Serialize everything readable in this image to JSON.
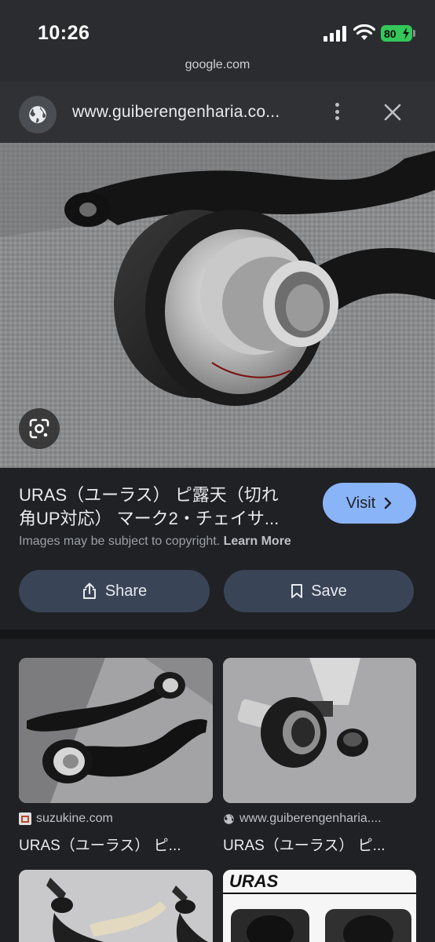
{
  "status_bar": {
    "time": "10:26",
    "battery": "80",
    "url": "google.com"
  },
  "header": {
    "site_url": "www.guiberengenharia.co...",
    "icons": [
      "globe-icon",
      "more-vert-icon",
      "close-icon"
    ]
  },
  "main_image": {
    "description_icon": "google-lens-icon"
  },
  "info": {
    "title_line1": "URAS（ユーラス） ピ露天（切れ",
    "title_line2": "角UP対応） マーク2・チェイサ...",
    "visit_label": "Visit",
    "copyright_text": "Images may be subject to copyright.",
    "learn_more": "Learn More",
    "share_label": "Share",
    "save_label": "Save"
  },
  "results": [
    {
      "source": "suzukine.com",
      "title": "URAS（ユーラス） ピ..."
    },
    {
      "source": "www.guiberengenharia....",
      "title": "URAS（ユーラス） ピ..."
    },
    {
      "source": "",
      "title": ""
    },
    {
      "source": "",
      "title": "",
      "logo_text": "URAS"
    }
  ],
  "colors": {
    "background": "#202124",
    "accent": "#8ab4f8",
    "button": "#394457",
    "battery": "#34c759"
  }
}
